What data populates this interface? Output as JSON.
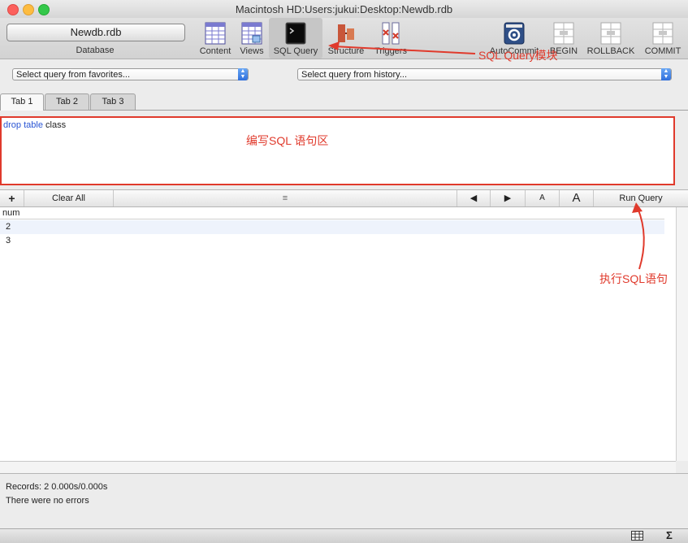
{
  "window": {
    "title": "Macintosh HD:Users:jukui:Desktop:Newdb.rdb"
  },
  "toolbar": {
    "database_button": "Newdb.rdb",
    "database_caption": "Database",
    "items": [
      {
        "label": "Content",
        "icon": "table-icon"
      },
      {
        "label": "Views",
        "icon": "views-icon"
      },
      {
        "label": "SQL Query",
        "icon": "terminal-icon",
        "selected": true
      },
      {
        "label": "Structure",
        "icon": "structure-icon"
      },
      {
        "label": "Triggers",
        "icon": "triggers-icon"
      }
    ],
    "right_items": [
      {
        "label": "AutoCommit",
        "icon": "gear-icon"
      },
      {
        "label": "BEGIN",
        "icon": "begin-icon"
      },
      {
        "label": "ROLLBACK",
        "icon": "rollback-icon"
      },
      {
        "label": "COMMIT",
        "icon": "commit-icon"
      }
    ]
  },
  "selectors": {
    "favorites": "Select query from favorites...",
    "history": "Select query from history..."
  },
  "tabs": [
    "Tab 1",
    "Tab 2",
    "Tab 3"
  ],
  "editor": {
    "keyword1": "drop",
    "keyword2": "table",
    "rest": "class"
  },
  "results_toolbar": {
    "add_label": "+",
    "clear_label": "Clear All",
    "font_small": "A",
    "font_large": "A",
    "run_label": "Run Query"
  },
  "results": {
    "column": "num",
    "rows": [
      "2",
      "3"
    ]
  },
  "status": {
    "records": "Records: 2  0.000s/0.000s",
    "errors": "There were no errors"
  },
  "annotations": {
    "sql_module": "SQL Query模块",
    "editor_area": "编写SQL 语句区",
    "run_sql": "执行SQL语句"
  },
  "colors": {
    "annotation": "#e03a2c",
    "keyword": "#2a55d4",
    "select_accent": "#2f6fdc"
  }
}
